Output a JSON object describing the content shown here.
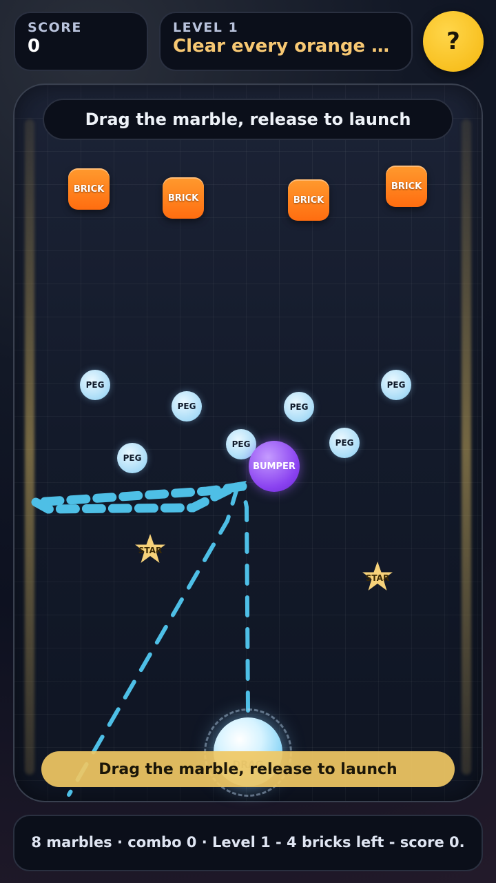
{
  "hud": {
    "score_label": "SCORE",
    "score_value": "0",
    "level_label": "LEVEL 1",
    "objective": "Clear every orange brick",
    "help_label": "?"
  },
  "top_instruction": "Drag the marble, release to launch",
  "bottom_instruction": "Drag the marble, release to launch",
  "bricks": [
    {
      "label": "BRICK"
    },
    {
      "label": "BRICK"
    },
    {
      "label": "BRICK"
    },
    {
      "label": "BRICK"
    }
  ],
  "pegs": [
    {
      "label": "PEG"
    },
    {
      "label": "PEG"
    },
    {
      "label": "PEG"
    },
    {
      "label": "PEG"
    },
    {
      "label": "PEG"
    },
    {
      "label": "PEG"
    },
    {
      "label": "PEG"
    }
  ],
  "bumper": {
    "label": "BUMPER"
  },
  "stars": [
    {
      "label": "STAR"
    },
    {
      "label": "STAR"
    }
  ],
  "marble": {
    "label": "DRAG"
  },
  "status": "8 marbles · combo 0 · Level 1 - 4 bricks left - score 0.",
  "colors": {
    "brick": "#ff7a18",
    "peg": "#bfe6fb",
    "bumper": "#8a42f0",
    "star": "#f7d27a",
    "trajectory": "#4ebfe6",
    "help_button": "#f5b70f",
    "objective_text": "#f7c873"
  }
}
